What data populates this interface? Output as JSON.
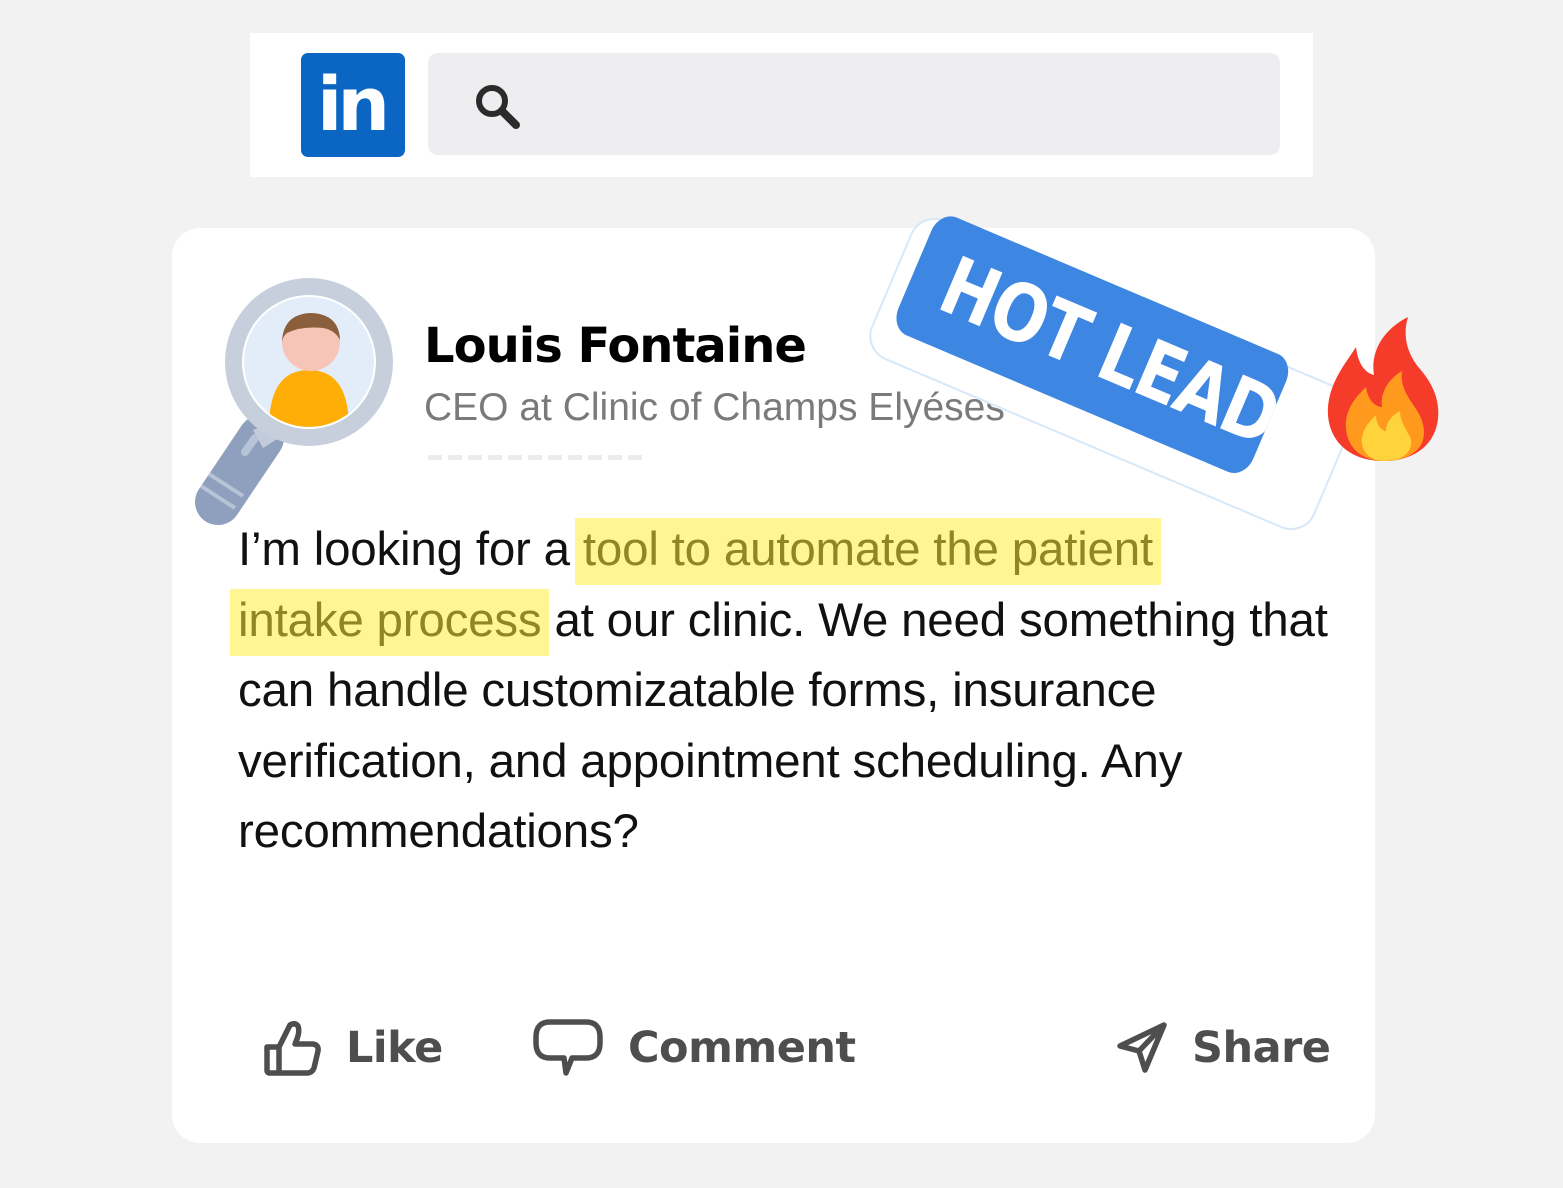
{
  "header": {
    "logo_text": "in",
    "logo_icon": "linkedin-logo",
    "search_icon": "search-icon",
    "search_value": "",
    "brand_color": "#0a66c2"
  },
  "post": {
    "author": {
      "name": "Louis Fontaine",
      "title": "CEO at Clinic of Champs Elyéses",
      "avatar_icon": "magnifier-avatar-icon"
    },
    "body": {
      "text_1": "I’m looking for a ",
      "highlight_1": "tool to automate the patient",
      "highlight_2": "intake process",
      "text_2": " at our clinic. We need something that can handle customizatable forms, insurance verification, and appointment scheduling. Any recommendations?"
    },
    "highlight_color": "#fff592",
    "badge": {
      "label": "HOT LEAD",
      "icon": "fire-icon",
      "color": "#3d86e2"
    },
    "actions": {
      "like": {
        "label": "Like",
        "icon": "thumbs-up-icon"
      },
      "comment": {
        "label": "Comment",
        "icon": "comment-icon"
      },
      "share": {
        "label": "Share",
        "icon": "send-icon"
      }
    }
  }
}
